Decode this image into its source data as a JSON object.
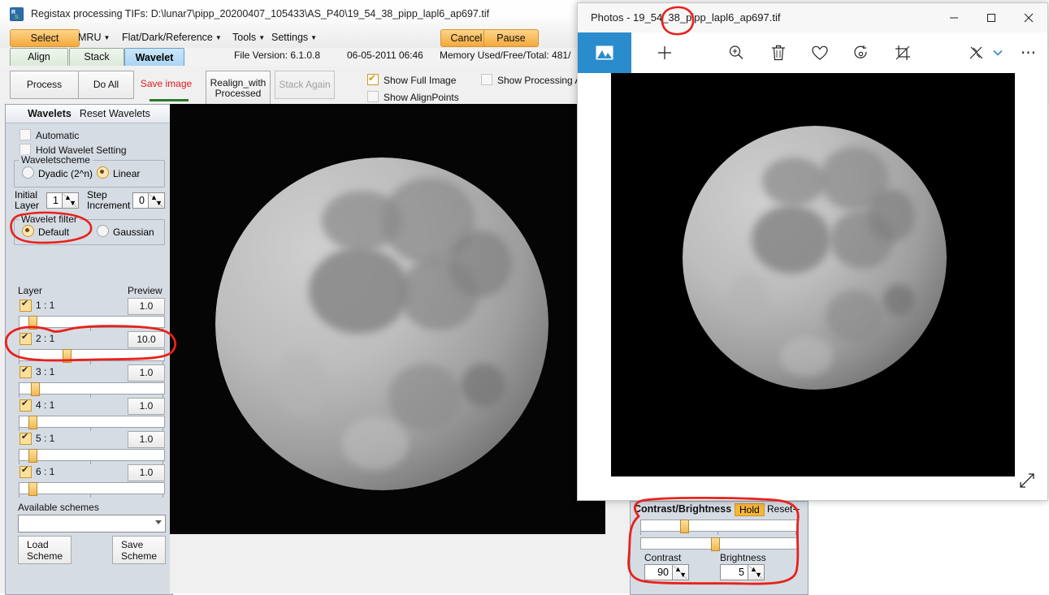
{
  "registax": {
    "title": "Registax processing TIFs: D:\\lunar7\\pipp_20200407_105433\\AS_P40\\19_54_38_pipp_lapl6_ap697.tif",
    "app_icon": "registax-logo-icon",
    "menubar": {
      "select": "Select",
      "mru": "MRU",
      "flat_dark_reference": "Flat/Dark/Reference",
      "tools": "Tools",
      "settings": "Settings",
      "cancel": "Cancel",
      "pause": "Pause"
    },
    "tabs": [
      {
        "label": "Align",
        "active": false
      },
      {
        "label": "Stack",
        "active": false
      },
      {
        "label": "Wavelet",
        "active": true
      }
    ],
    "status": {
      "file_version": "File Version: 6.1.0.8",
      "date": "06-05-2011 06:46",
      "memory": "Memory Used/Free/Total: 481/"
    },
    "actions": {
      "process": "Process",
      "do_all": "Do All",
      "save_image": "Save image",
      "realign_with_processed": "Realign_with\nProcessed",
      "stack_again": "Stack Again"
    },
    "checkboxes": {
      "show_full_image": {
        "label": "Show Full Image",
        "checked": true
      },
      "show_alignpoints": {
        "label": "Show AlignPoints",
        "checked": false
      },
      "show_processing_area": {
        "label": "Show Processing Ar",
        "checked": false
      }
    }
  },
  "wavelets": {
    "header_title": "Wavelets",
    "header_reset": "Reset Wavelets",
    "automatic": {
      "label": "Automatic",
      "checked": false
    },
    "hold_wavelet_setting": {
      "label": "Hold Wavelet Setting",
      "checked": false
    },
    "waveletscheme": {
      "group_label": "Waveletscheme",
      "dyadic": {
        "label": "Dyadic (2^n)",
        "selected": false
      },
      "linear": {
        "label": "Linear",
        "selected": true
      }
    },
    "initial_layer": {
      "label_line1": "Initial",
      "label_line2": "Layer",
      "value": "1"
    },
    "step_increment": {
      "label_line1": "Step",
      "label_line2": "Increment",
      "value": "0"
    },
    "wavelet_filter": {
      "group_label": "Wavelet filter",
      "default": {
        "label": "Default",
        "selected": true
      },
      "gaussian": {
        "label": "Gaussian",
        "selected": false
      }
    },
    "columns": {
      "layer": "Layer",
      "preview": "Preview"
    },
    "layers": [
      {
        "name": "1 : 1",
        "checked": true,
        "preview": "1.0",
        "slider_pct": 6
      },
      {
        "name": "2 : 1",
        "checked": true,
        "preview": "10.0",
        "slider_pct": 30
      },
      {
        "name": "3 : 1",
        "checked": true,
        "preview": "1.0",
        "slider_pct": 8
      },
      {
        "name": "4 : 1",
        "checked": true,
        "preview": "1.0",
        "slider_pct": 6
      },
      {
        "name": "5 : 1",
        "checked": true,
        "preview": "1.0",
        "slider_pct": 6
      },
      {
        "name": "6 : 1",
        "checked": true,
        "preview": "1.0",
        "slider_pct": 6
      }
    ],
    "available_schemes": {
      "label": "Available schemes",
      "value": ""
    },
    "load_scheme": "Load\nScheme",
    "save_scheme": "Save\nScheme"
  },
  "contrast_brightness": {
    "title": "Contrast/Brightness",
    "hold": "Hold",
    "reset": "Reset",
    "minimize": "–",
    "contrast": {
      "label": "Contrast",
      "value": "90",
      "slider_pct": 25
    },
    "brightness": {
      "label": "Brightness",
      "value": "5",
      "slider_pct": 45
    }
  },
  "photos_window": {
    "title": "Photos - 19_54_38_pipp_lapl6_ap697.tif",
    "window_buttons": {
      "minimize": "─",
      "maximize": "□",
      "close": "✕"
    },
    "toolbar_icons": [
      "picture-icon",
      "add-icon",
      "zoom-icon",
      "delete-icon",
      "favorite-icon",
      "rotate-icon",
      "crop-icon",
      "enhance-icon",
      "chevron-down-icon",
      "more-icon"
    ],
    "expand_icon": "fullscreen-icon"
  },
  "annotations": {
    "color": "#e8211b",
    "marks": [
      "circle-around-wavelet-filter-default",
      "circle-around-layer2-row",
      "circle-around-pipp-in-photos-title",
      "circle-around-contrast-brightness-panel"
    ]
  }
}
